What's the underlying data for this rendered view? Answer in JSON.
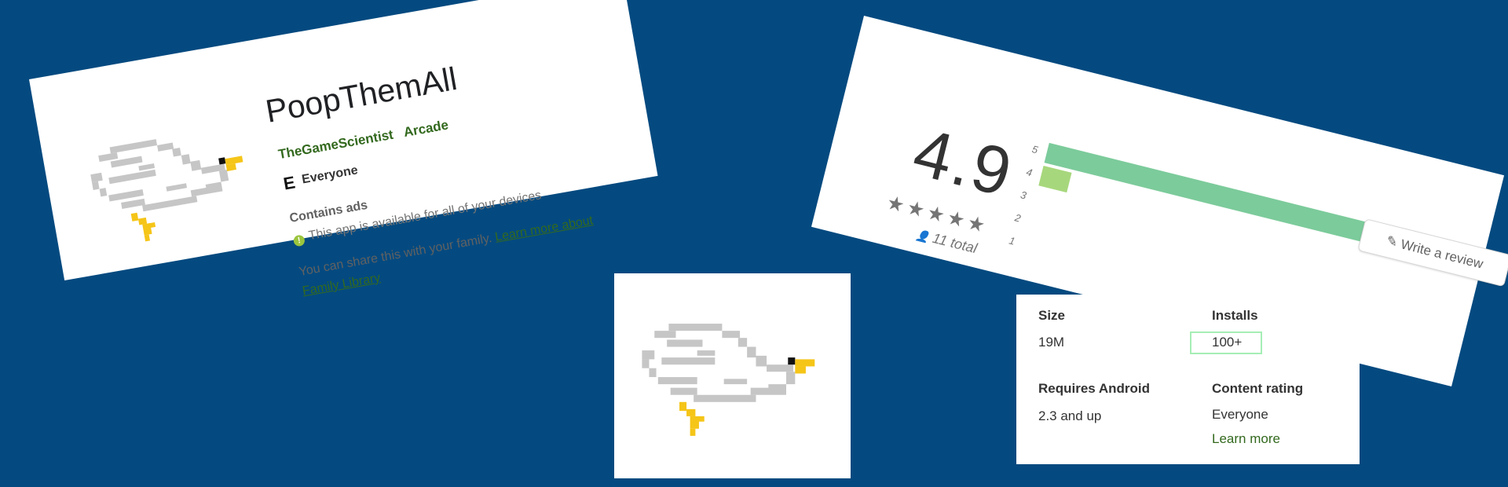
{
  "app": {
    "title": "PoopThemAll",
    "developer": "TheGameScientist",
    "category": "Arcade",
    "content_rating": "Everyone",
    "esrb_badge": "E",
    "contains_ads": "Contains ads",
    "availability": "This app is available for all of your devices",
    "share_text": "You can share this with your family.",
    "learn_more_about": "Learn more about",
    "family_library": "Family Library",
    "bird_icon": "seagull-pixel-icon"
  },
  "rating": {
    "score": "4.9",
    "stars": "★★★★★",
    "total": "11 total",
    "write_review": "Write a review",
    "bars": [
      {
        "label": "5",
        "fraction": 1.0,
        "color": "#7ccb9b"
      },
      {
        "label": "4",
        "fraction": 0.08,
        "color": "#a7d77c"
      },
      {
        "label": "3",
        "fraction": 0,
        "color": "#ffd54f"
      },
      {
        "label": "2",
        "fraction": 0,
        "color": "#ffb74d"
      },
      {
        "label": "1",
        "fraction": 0,
        "color": "#ff8a65"
      }
    ]
  },
  "info": {
    "size_label": "Size",
    "size_value": "19M",
    "installs_label": "Installs",
    "installs_value": "100+",
    "requires_label": "Requires Android",
    "requires_value": "2.3 and up",
    "content_rating_label": "Content rating",
    "content_rating_value": "Everyone",
    "learn_more": "Learn more"
  },
  "colors": {
    "background": "#044a80",
    "accent_green": "#33691e",
    "bird_gray": "#c6c6c6",
    "beak_yellow": "#f5c518"
  }
}
